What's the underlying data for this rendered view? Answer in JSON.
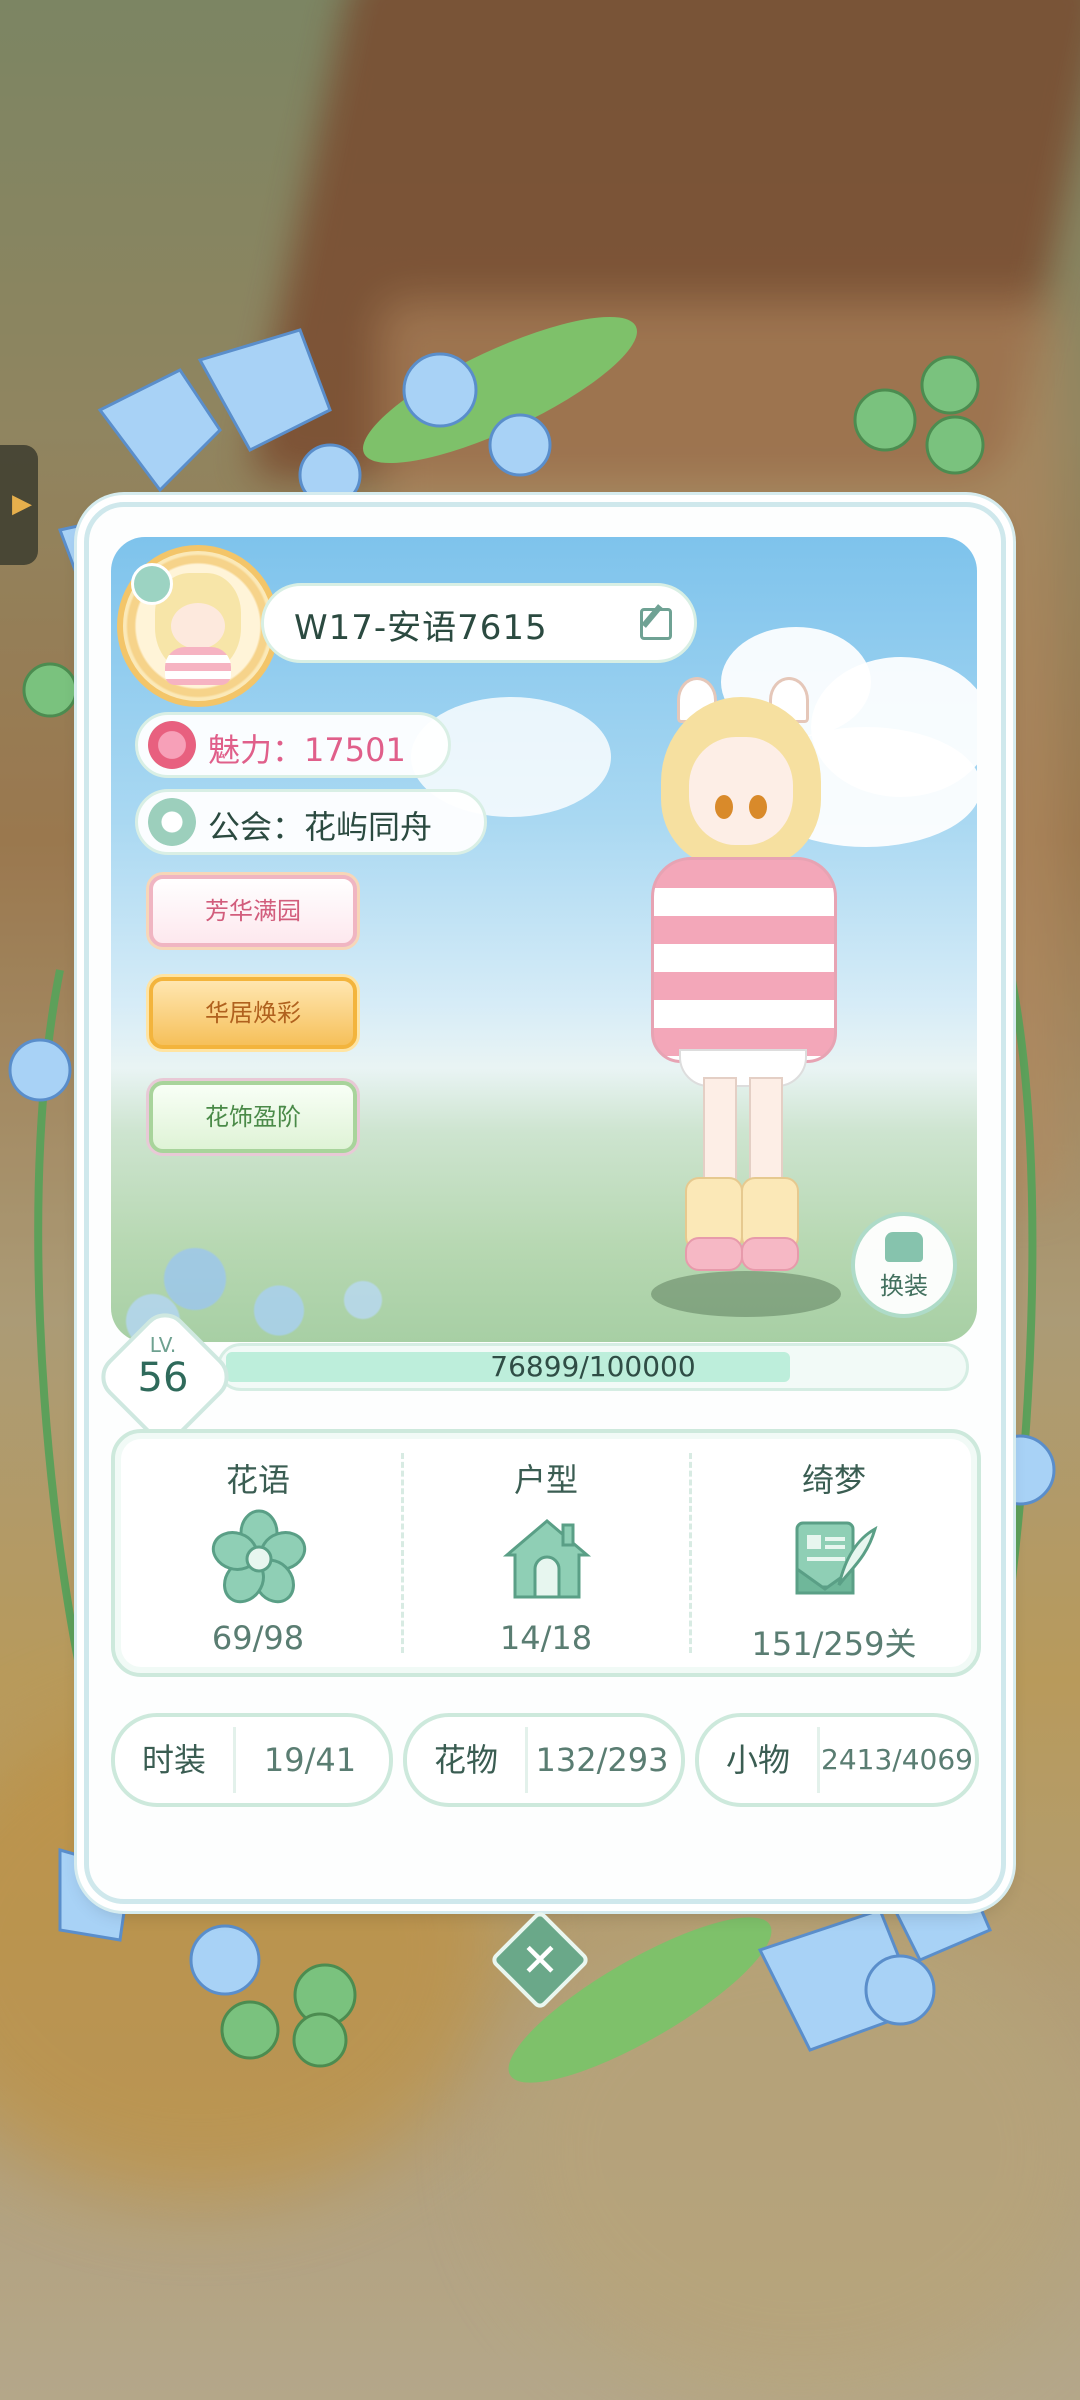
{
  "player": {
    "name": "W17-安语7615",
    "charm_label": "魅力：17501",
    "guild_label": "公会：花屿同舟"
  },
  "titles": [
    "芳华满园",
    "华居焕彩",
    "花饰盈阶"
  ],
  "change_outfit_label": "换装",
  "level": {
    "lv_label": "LV.",
    "value": "56",
    "xp_text": "76899/100000",
    "xp_fraction": 0.769
  },
  "collection": [
    {
      "title": "花语",
      "value": "69/98",
      "icon": "flower-icon"
    },
    {
      "title": "户型",
      "value": "14/18",
      "icon": "house-icon"
    },
    {
      "title": "绮梦",
      "value": "151/259关",
      "icon": "letter-quill-icon"
    }
  ],
  "stats": [
    {
      "key": "时装",
      "value": "19/41"
    },
    {
      "key": "花物",
      "value": "132/293"
    },
    {
      "key": "小物",
      "value": "2413/4069"
    }
  ],
  "colors": {
    "accent": "#6aa889",
    "charm_pink": "#e05f8a",
    "text_dark": "#2b4a40"
  }
}
